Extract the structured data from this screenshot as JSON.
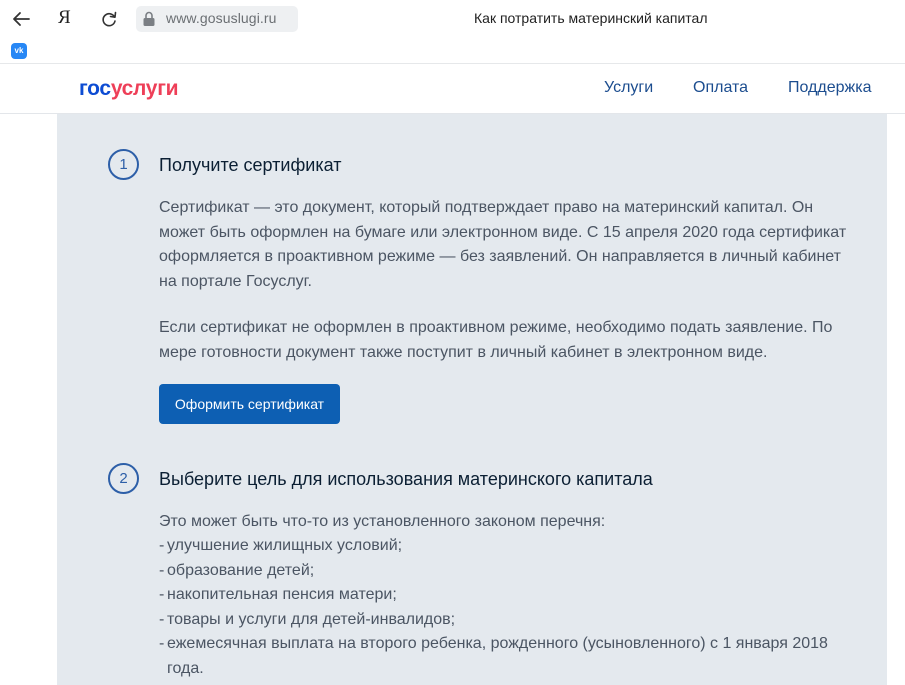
{
  "browser": {
    "yandex_label": "Я",
    "url": "www.gosuslugi.ru",
    "tab_title": "Как потратить материнский капитал",
    "bookmark_vk": "vk"
  },
  "header": {
    "logo_part1": "гос",
    "logo_part2": "услуги",
    "nav": [
      "Услуги",
      "Оплата",
      "Поддержка"
    ]
  },
  "steps": [
    {
      "number": "1",
      "title": "Получите сертификат",
      "paragraphs": [
        "Сертификат — это документ, который подтверждает право на материнский капитал. Он может быть оформлен на бумаге или электронном виде. С 15 апреля 2020 года сертификат оформляется в проактивном режиме — без заявлений. Он направляется в личный кабинет на портале Госуслуг.",
        "Если сертификат не оформлен в проактивном режиме, необходимо подать заявление. По мере готовности документ также поступит в личный кабинет в электронном виде."
      ],
      "button": "Оформить сертификат"
    },
    {
      "number": "2",
      "title": "Выберите цель для использования материнского капитала",
      "intro": "Это может быть что-то из установленного законом перечня:",
      "items": [
        "улучшение жилищных условий;",
        "образование детей;",
        "накопительная пенсия матери;",
        "товары и услуги для детей-инвалидов;",
        "ежемесячная выплата на второго ребенка, рожденного (усыновленного) с 1 января 2018 года."
      ]
    }
  ],
  "colors": {
    "panel_bg": "#e4e9ee",
    "primary_button": "#0d5fb3",
    "nav_link": "#1c4d8f",
    "logo_blue": "#0d4cd3",
    "logo_red": "#ee3f58"
  }
}
